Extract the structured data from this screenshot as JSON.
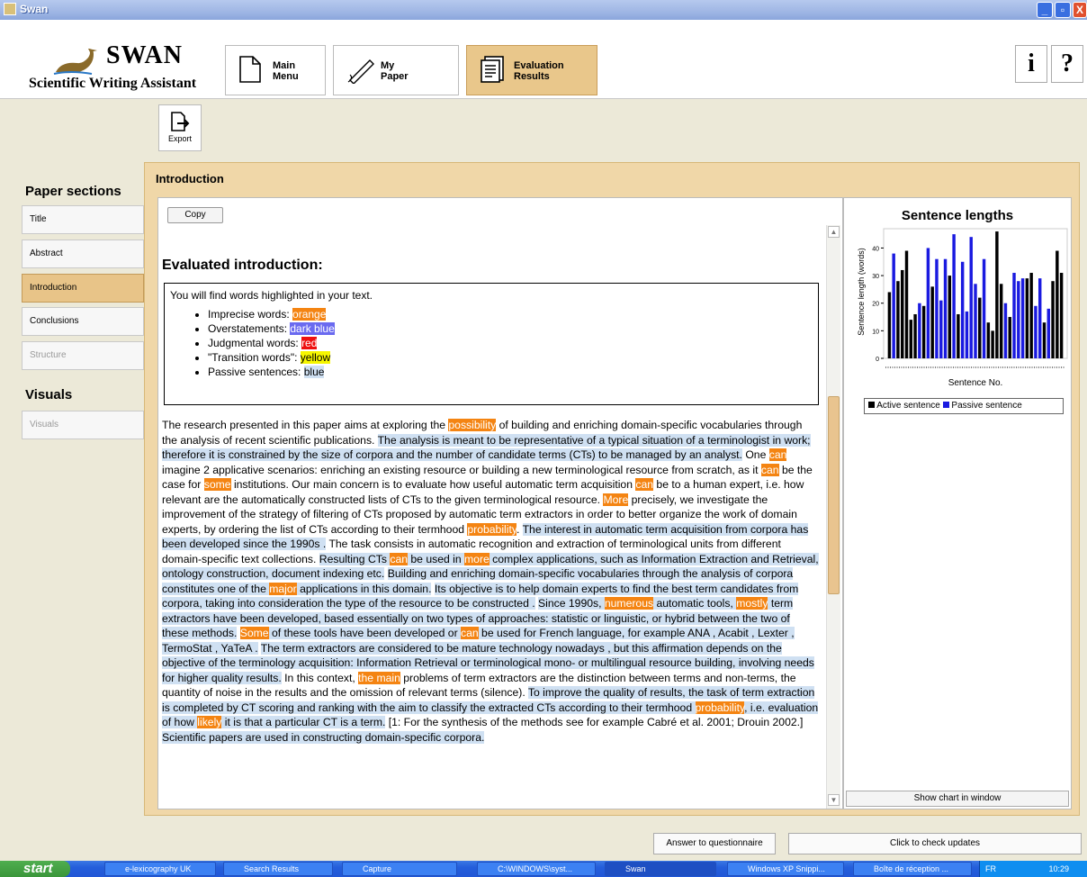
{
  "window": {
    "title": "Swan",
    "min": "_",
    "restore": "▫",
    "close": "X"
  },
  "logo": {
    "title": "SWAN",
    "subtitle": "Scientific Writing Assistant"
  },
  "tabs": [
    {
      "label": "Main\nMenu",
      "icon": "document-icon"
    },
    {
      "label": "My\nPaper",
      "icon": "pen-icon"
    },
    {
      "label": "Evaluation\nResults",
      "icon": "report-icon"
    }
  ],
  "help": {
    "info": "i",
    "question": "?"
  },
  "export": {
    "label": "Export"
  },
  "sidebar": {
    "sections_header": "Paper sections",
    "items": [
      {
        "label": "Title"
      },
      {
        "label": "Abstract"
      },
      {
        "label": "Introduction"
      },
      {
        "label": "Conclusions"
      },
      {
        "label": "Structure"
      }
    ],
    "visuals_header": "Visuals",
    "visuals_items": [
      {
        "label": "Visuals"
      }
    ]
  },
  "panel": {
    "title": "Introduction",
    "copy": "Copy",
    "heading": "Evaluated introduction:",
    "legend_intro": "You will find words highlighted in your text.",
    "legend": [
      {
        "prefix": "Imprecise words: ",
        "word": "orange"
      },
      {
        "prefix": "Overstatements: ",
        "word": "dark blue"
      },
      {
        "prefix": "Judgmental words: ",
        "word": "red"
      },
      {
        "prefix": "\"Transition words\": ",
        "word": "yellow"
      },
      {
        "prefix": "Passive sentences: ",
        "word": "blue"
      }
    ]
  },
  "chart_data": {
    "type": "bar",
    "title": "Sentence lengths",
    "xlabel": "Sentence No.",
    "ylabel": "Sentence length (words)",
    "ylim": [
      0,
      47
    ],
    "yticks": [
      0,
      10,
      20,
      30,
      40
    ],
    "series_colors": {
      "Active sentence": "#000000",
      "Passive sentence": "#1a1ae0"
    },
    "legend": [
      "Active sentence",
      "Passive sentence"
    ],
    "values": [
      24,
      38,
      28,
      32,
      39,
      14,
      16,
      20,
      19,
      40,
      26,
      36,
      21,
      36,
      30,
      45,
      16,
      35,
      17,
      44,
      27,
      22,
      36,
      13,
      10,
      46,
      27,
      20,
      15,
      31,
      28,
      29,
      29,
      31,
      19,
      29,
      13,
      18,
      28,
      39,
      31
    ],
    "passive": [
      0,
      1,
      0,
      0,
      0,
      0,
      0,
      1,
      0,
      1,
      0,
      1,
      1,
      1,
      0,
      1,
      0,
      1,
      1,
      1,
      1,
      0,
      1,
      0,
      0,
      0,
      0,
      1,
      0,
      1,
      1,
      1,
      0,
      0,
      1,
      1,
      0,
      1,
      0,
      0,
      0
    ],
    "show_chart_label": "Show chart in window"
  },
  "bottom": {
    "questionnaire": "Answer to questionnaire",
    "updates": "Click to check updates"
  },
  "taskbar": {
    "start": "start",
    "items": [
      "e-lexicography UK",
      "Search Results",
      "Capture",
      "C:\\WINDOWS\\syst...",
      "Swan",
      "Windows XP Snippi...",
      "Boîte de réception ..."
    ],
    "lang": "FR",
    "time": "10:29"
  }
}
